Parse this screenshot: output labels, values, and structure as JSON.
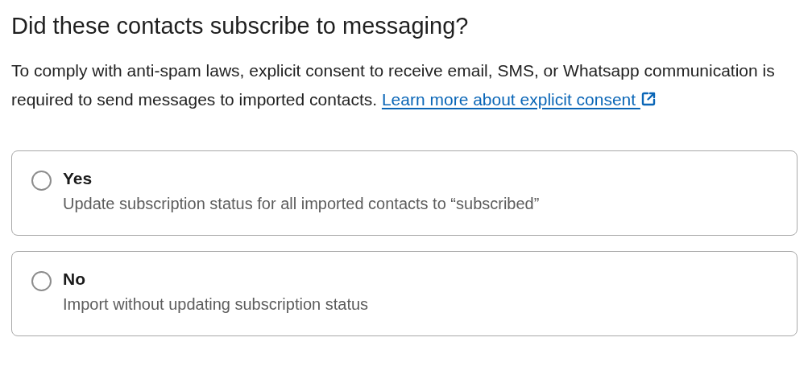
{
  "title": "Did these contacts subscribe to messaging?",
  "description": {
    "text": "To comply with anti-spam laws, explicit consent to receive email, SMS, or Whatsapp communication is required to send messages to imported contacts.",
    "link": "Learn more about explicit consent"
  },
  "options": [
    {
      "label": "Yes",
      "detail": "Update subscription status for all imported contacts to “subscribed”",
      "selected": false
    },
    {
      "label": "No",
      "detail": "Import without updating subscription status",
      "selected": false
    }
  ]
}
